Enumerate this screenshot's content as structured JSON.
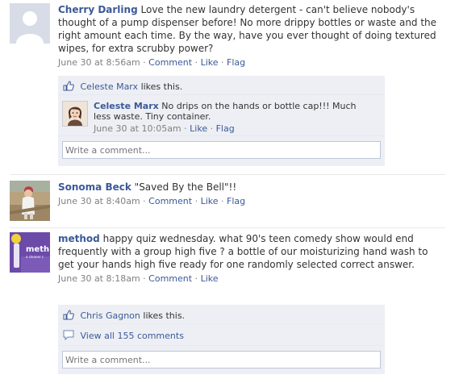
{
  "feed": [
    {
      "author": "Cherry Darling",
      "message": "Love the new laundry detergent - can't believe nobody's thought of a pump dispenser before! No more drippy bottles or waste and the right amount each time. By the way, have you ever thought of doing textured wipes, for extra scrubby power?",
      "time": "June 30 at 8:56am",
      "actions": [
        "Comment",
        "Like",
        "Flag"
      ],
      "likes": {
        "name": "Celeste Marx",
        "suffix": "likes this."
      },
      "comments": [
        {
          "author": "Celeste Marx",
          "text": "No drips on the hands or bottle cap!!! Much less waste. Tiny container.",
          "time": "June 30 at 10:05am",
          "actions": [
            "Like",
            "Flag"
          ]
        }
      ],
      "input_placeholder": "Write a comment..."
    },
    {
      "author": "Sonoma Beck",
      "message": "\"Saved By the Bell\"!!",
      "time": "June 30 at 8:40am",
      "actions": [
        "Comment",
        "Like",
        "Flag"
      ]
    },
    {
      "author": "method",
      "message": "happy quiz wednesday. what 90's teen comedy show would end frequently with a group high five ? a bottle of our moisturizing hand wash to get your hands high five ready for one randomly selected correct answer.",
      "time": "June 30 at 8:18am",
      "actions": [
        "Comment",
        "Like"
      ],
      "likes": {
        "name": "Chris Gagnon",
        "suffix": "likes this."
      },
      "view_all": "View all 155 comments",
      "input_placeholder": "Write a comment...",
      "avatar_text": "meth",
      "avatar_subtext": "a cleaner c"
    }
  ],
  "colors": {
    "link": "#3b5998",
    "ufi_bg": "#edeff4",
    "meta": "#808080"
  }
}
